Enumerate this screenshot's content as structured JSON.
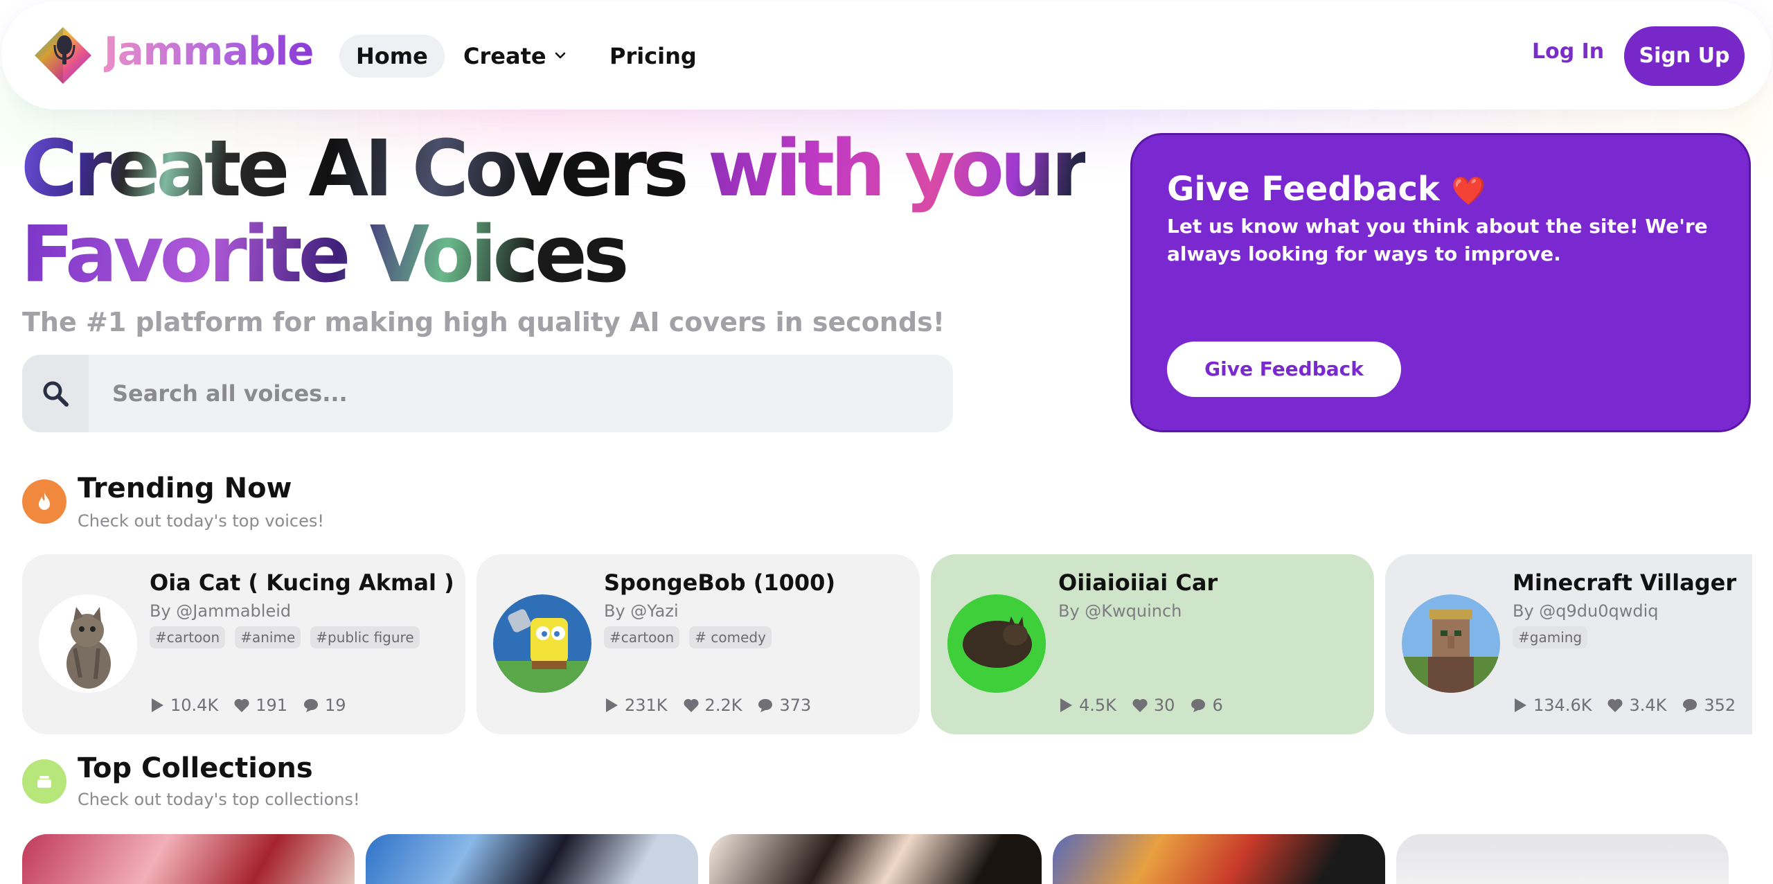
{
  "nav": {
    "brand": "Jammable",
    "links": {
      "home": "Home",
      "create": "Create",
      "pricing": "Pricing"
    },
    "login": "Log In",
    "signup": "Sign Up"
  },
  "hero": {
    "title_line1_a": "Create AI Covers ",
    "title_line1_b": "with your",
    "title_line2": "Favorite Voices",
    "subtitle": "The #1 platform for making high quality AI covers in seconds!",
    "search_placeholder": "Search all voices..."
  },
  "feedback": {
    "title": "Give Feedback",
    "heart": "❤️",
    "text": "Let us know what you think about the site! We're always looking for ways to improve.",
    "button": "Give Feedback"
  },
  "trending": {
    "title": "Trending Now",
    "subtitle": "Check out today's top voices!",
    "cards": [
      {
        "name": "Oia Cat ( Kucing Akmal )",
        "by": "By @Jammableid",
        "tags": [
          "#cartoon",
          "#anime",
          "#public figure"
        ],
        "plays": "10.4K",
        "likes": "191",
        "comments": "19"
      },
      {
        "name": "SpongeBob (1000)",
        "by": "By @Yazi",
        "tags": [
          "#cartoon",
          "# comedy"
        ],
        "plays": "231K",
        "likes": "2.2K",
        "comments": "373"
      },
      {
        "name": "Oiiaioiiai Car",
        "by": "By @Kwquinch",
        "tags": [],
        "plays": "4.5K",
        "likes": "30",
        "comments": "6"
      },
      {
        "name": "Minecraft Villager",
        "by": "By @q9du0qwdiq",
        "tags": [
          "#gaming"
        ],
        "plays": "134.6K",
        "likes": "3.4K",
        "comments": "352"
      }
    ]
  },
  "collections": {
    "title": "Top Collections",
    "subtitle": "Check out today's top collections!"
  },
  "colors": {
    "brand_purple": "#7828c8",
    "trending_icon": "#f0883e",
    "collections_icon": "#b7e67a",
    "highlight_card": "#cfe5c9"
  },
  "icons": [
    "search-icon",
    "flame-icon",
    "collection-icon",
    "play-icon",
    "heart-icon",
    "comment-icon",
    "chevron-down-icon"
  ]
}
